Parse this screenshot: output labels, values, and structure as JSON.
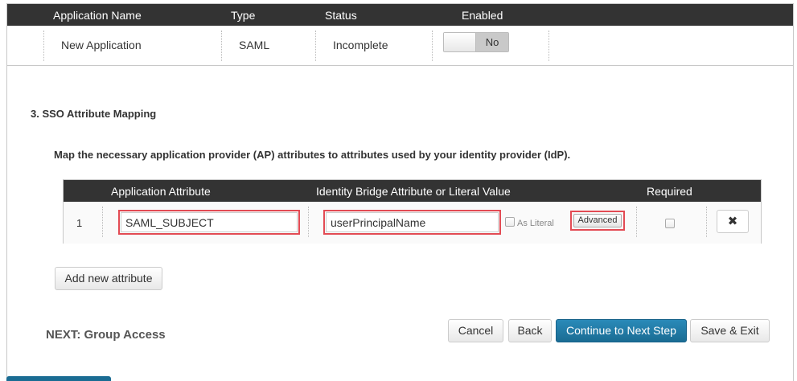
{
  "app_table": {
    "headers": [
      "Application Name",
      "Type",
      "Status",
      "Enabled"
    ],
    "row": {
      "name": "New Application",
      "type": "SAML",
      "status": "Incomplete",
      "enabled_state": "No"
    }
  },
  "section": {
    "title": "3. SSO Attribute Mapping",
    "description": "Map the necessary application provider (AP) attributes to attributes used by your identity provider (IdP)."
  },
  "attr_table": {
    "headers": [
      "Application Attribute",
      "Identity Bridge Attribute or Literal Value",
      "Required"
    ],
    "rows": [
      {
        "index": "1",
        "app_attribute": "SAML_SUBJECT",
        "idp_attribute": "userPrincipalName",
        "literal_label": "As Literal",
        "advanced_label": "Advanced",
        "delete_symbol": "✖"
      }
    ]
  },
  "actions": {
    "add_attribute": "Add new attribute",
    "next_label": "NEXT: Group Access",
    "cancel": "Cancel",
    "back": "Back",
    "continue": "Continue to Next Step",
    "save_exit": "Save & Exit"
  },
  "colors": {
    "header_bg": "#333333",
    "primary": "#1a6c93",
    "highlight": "#e34b54"
  }
}
